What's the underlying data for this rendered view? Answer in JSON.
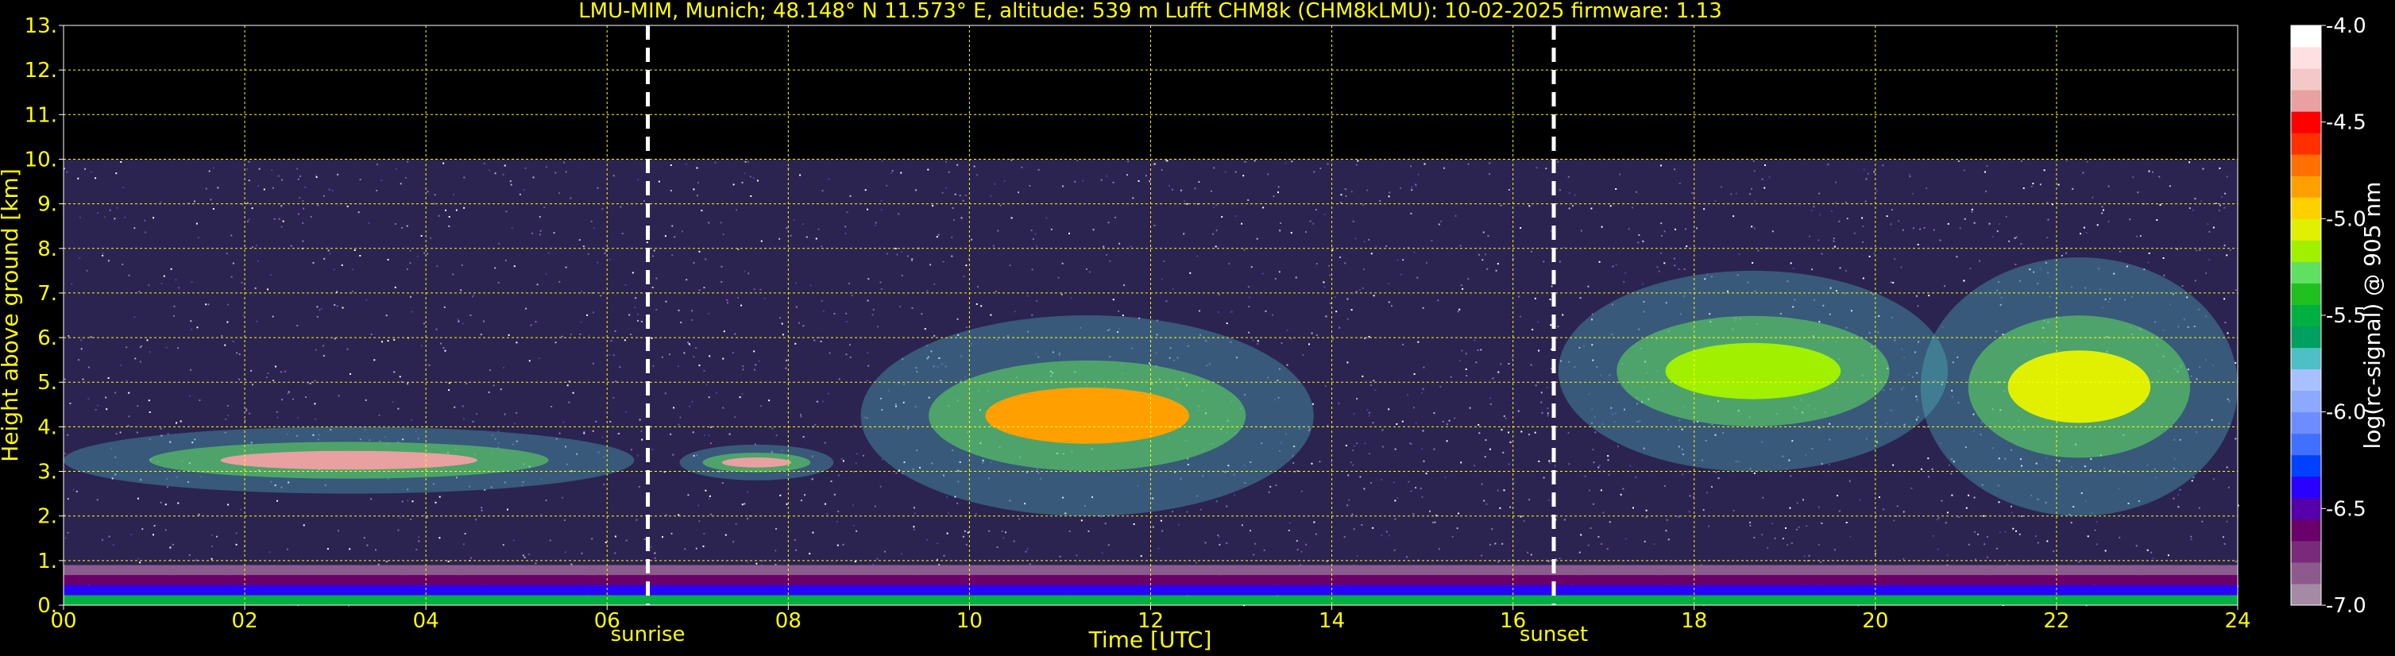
{
  "chart_data": {
    "type": "heatmap",
    "title": "LMU-MIM, Munich; 48.148° N 11.573° E, altitude: 539 m    Lufft CHM8k (CHM8kLMU): 10-02-2025    firmware: 1.13",
    "xlabel": "Time [UTC]",
    "ylabel": "Height above ground [km]",
    "colorbar_label": "log(rc-signal) @ 905 nm",
    "xlim": [
      0,
      24
    ],
    "ylim": [
      0,
      13
    ],
    "x_ticks": [
      "00",
      "02",
      "04",
      "06",
      "08",
      "10",
      "12",
      "14",
      "16",
      "18",
      "20",
      "22",
      "24"
    ],
    "x_tick_values": [
      0,
      2,
      4,
      6,
      8,
      10,
      12,
      14,
      16,
      18,
      20,
      22,
      24
    ],
    "y_ticks": [
      "0.",
      "1.",
      "2.",
      "3.",
      "4.",
      "5.",
      "6.",
      "7.",
      "8.",
      "9.",
      "10.",
      "11.",
      "12.",
      "13."
    ],
    "y_tick_values": [
      0,
      1,
      2,
      3,
      4,
      5,
      6,
      7,
      8,
      9,
      10,
      11,
      12,
      13
    ],
    "grid": true,
    "data_top_km": 10,
    "colorbar_range": [
      -7.0,
      -4.0
    ],
    "colorbar_ticks": [
      "-4.0",
      "-4.5",
      "-5.0",
      "-5.5",
      "-6.0",
      "-6.5",
      "-7.0"
    ],
    "colorbar_tick_values": [
      -4.0,
      -4.5,
      -5.0,
      -5.5,
      -6.0,
      -6.5,
      -7.0
    ],
    "colormap": [
      "#a58aa5",
      "#8c5a8c",
      "#7a2a7a",
      "#6a006a",
      "#5500aa",
      "#2a00ff",
      "#0040ff",
      "#4070ff",
      "#6d8cff",
      "#8ca8ff",
      "#a8c0ff",
      "#4fbfc6",
      "#00a060",
      "#00b040",
      "#20c020",
      "#60e060",
      "#a0f000",
      "#e0f000",
      "#ffd000",
      "#ffa000",
      "#ff7000",
      "#ff3000",
      "#ff0000",
      "#e8a0a0",
      "#f4c8c8",
      "#ffe0e0",
      "#ffffff"
    ],
    "markers": [
      {
        "label": "sunrise",
        "x": 6.45
      },
      {
        "label": "sunset",
        "x": 16.45
      }
    ],
    "features": [
      {
        "name": "boundary layer aerosol",
        "x_range": [
          0,
          24
        ],
        "height_km": [
          0,
          0.9
        ],
        "log_signal": -5.8
      },
      {
        "name": "low cloud layer",
        "x_range": [
          0,
          6.3
        ],
        "height_km": [
          2.5,
          4.0
        ],
        "log_signal": -4.3
      },
      {
        "name": "cloud layer",
        "x_range": [
          6.8,
          8.5
        ],
        "height_km": [
          2.8,
          3.6
        ],
        "log_signal": -4.4
      },
      {
        "name": "cloud band",
        "x_range": [
          8.8,
          13.8
        ],
        "height_km": [
          2.0,
          6.5
        ],
        "log_signal": -4.8
      },
      {
        "name": "cloud band",
        "x_range": [
          16.5,
          20.8
        ],
        "height_km": [
          3.0,
          7.5
        ],
        "log_signal": -5.2
      },
      {
        "name": "cloud band",
        "x_range": [
          20.5,
          24
        ],
        "height_km": [
          2.0,
          7.8
        ],
        "log_signal": -5.0
      }
    ]
  }
}
